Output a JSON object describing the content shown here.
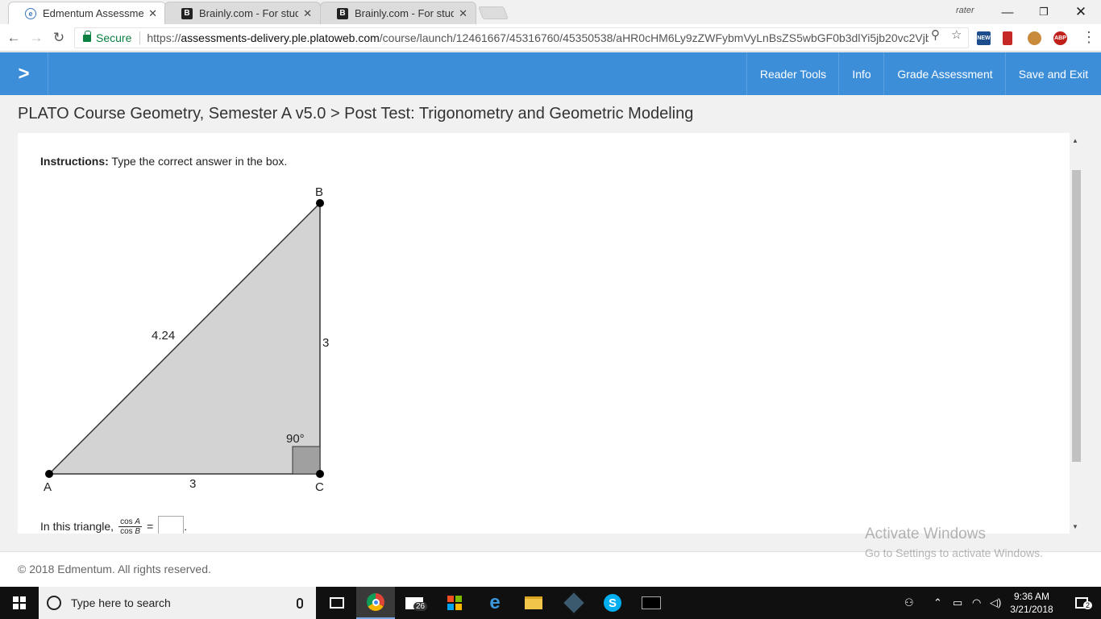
{
  "browser": {
    "tabs": [
      {
        "title": "Edmentum Assessments",
        "favicon": "edmentum-icon",
        "active": true
      },
      {
        "title": "Brainly.com - For students",
        "favicon": "brainly-icon",
        "active": false
      },
      {
        "title": "Brainly.com - For students",
        "favicon": "brainly-icon",
        "active": false
      }
    ],
    "user": "rater",
    "secure_label": "Secure",
    "url_scheme": "https://",
    "url_host": "assessments-delivery.ple.platoweb.com",
    "url_path": "/course/launch/12461667/45316760/45350538/aHR0cHM6Ly9zZWFybmVyLnBsZS5wbGF0b3dlYi5jb20vc2Vjb..."
  },
  "appbar": {
    "reader_tools": "Reader Tools",
    "info": "Info",
    "grade_assessment": "Grade Assessment",
    "save_exit": "Save and Exit",
    "color": "#3d8ed9"
  },
  "breadcrumb": "PLATO Course Geometry, Semester A v5.0 > Post Test: Trigonometry and Geometric Modeling",
  "question": {
    "instructions_label": "Instructions:",
    "instructions_text": "Type the correct answer in the box.",
    "prompt": "In this triangle,",
    "fraction_num_fn": "cos",
    "fraction_num_var": "A",
    "fraction_den_fn": "cos",
    "fraction_den_var": "B",
    "equals": "=",
    "answer_value": "",
    "trailing": "."
  },
  "diagram": {
    "vertices": {
      "a": "A",
      "b": "B",
      "c": "C"
    },
    "side_ab": "4.24",
    "side_bc": "3",
    "side_ac": "3",
    "right_angle_label": "90°",
    "fill_color": "#d3d3d3"
  },
  "footer": "© 2018 Edmentum. All rights reserved.",
  "watermark": {
    "line1": "Activate Windows",
    "line2": "Go to Settings to activate Windows."
  },
  "taskbar": {
    "search_placeholder": "Type here to search",
    "mail_badge": "26",
    "time": "9:36 AM",
    "date": "3/21/2018",
    "notification_count": "2"
  }
}
